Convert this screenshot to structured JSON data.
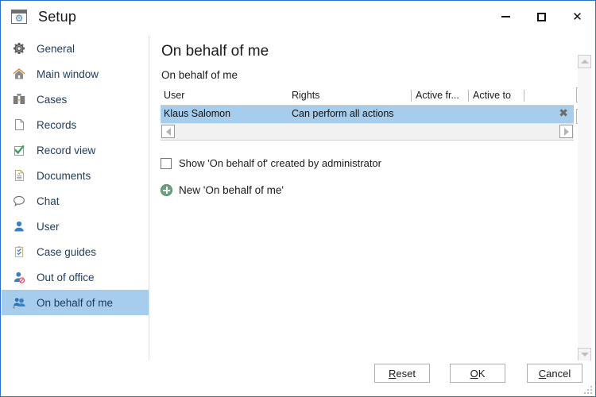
{
  "window": {
    "title": "Setup",
    "icon": "setup-gear-icon",
    "border_color": "#2b74c5",
    "controls": {
      "minimize": "minimize-icon",
      "maximize": "maximize-icon",
      "close": "close-icon"
    }
  },
  "sidebar": {
    "items": [
      {
        "label": "General",
        "icon": "gear-icon",
        "selected": false
      },
      {
        "label": "Main window",
        "icon": "home-icon",
        "selected": false
      },
      {
        "label": "Cases",
        "icon": "briefcase-icon",
        "selected": false
      },
      {
        "label": "Records",
        "icon": "page-icon",
        "selected": false
      },
      {
        "label": "Record view",
        "icon": "checkmark-icon",
        "selected": false
      },
      {
        "label": "Documents",
        "icon": "document-icon",
        "selected": false
      },
      {
        "label": "Chat",
        "icon": "chat-bubble-icon",
        "selected": false
      },
      {
        "label": "User",
        "icon": "user-icon",
        "selected": false
      },
      {
        "label": "Case guides",
        "icon": "clipboard-icon",
        "selected": false
      },
      {
        "label": "Out of office",
        "icon": "user-blocked-icon",
        "selected": false
      },
      {
        "label": "On behalf of me",
        "icon": "users-swap-icon",
        "selected": true
      }
    ],
    "selected_color": "#a6cdeb"
  },
  "main": {
    "title": "On behalf of me",
    "subtitle": "On behalf of me",
    "grid": {
      "columns": [
        "User",
        "Rights",
        "Active fr...",
        "Active to",
        ""
      ],
      "rows": [
        {
          "user": "Klaus Salomon",
          "rights": "Can perform all actions",
          "active_from": "",
          "active_to": "",
          "delete": "✖",
          "selected": true
        }
      ],
      "selected_row_color": "#a6cdeb"
    },
    "checkbox": {
      "label": "Show 'On behalf of' created by administrator",
      "checked": false
    },
    "new_link": {
      "label": "New 'On behalf of me'",
      "icon": "plus-circle-icon",
      "icon_color": "#6fa07f"
    }
  },
  "footer": {
    "buttons": [
      {
        "name": "reset",
        "accel": "R",
        "rest": "eset"
      },
      {
        "name": "ok",
        "accel": "O",
        "rest": "K"
      },
      {
        "name": "cancel",
        "accel": "C",
        "rest": "ancel"
      }
    ]
  }
}
